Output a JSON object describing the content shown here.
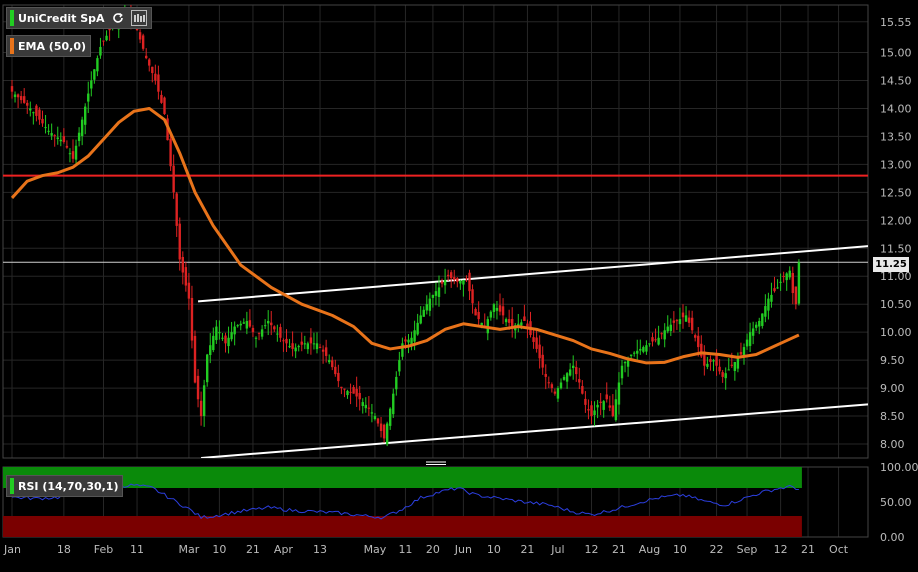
{
  "instrument": {
    "name": "UniCredit SpA",
    "color": "#22cc22",
    "refresh_icon": "refresh-icon",
    "bars_icon": "candlestick-bars-icon"
  },
  "ema": {
    "label": "EMA (50,0)",
    "color": "#e8731a"
  },
  "rsi": {
    "label": "RSI (14,70,30,1)",
    "color": "#22cc22",
    "line_color": "#2c3fe0",
    "overbought_color": "#0a8a0a",
    "oversold_color": "#7a0000"
  },
  "last_price": "11.25",
  "colors": {
    "up": "#22cc22",
    "down": "#dd2222",
    "background": "#000000",
    "grid": "#262626",
    "resistance": "#ee2222",
    "channel": "#ffffff"
  },
  "chart_data": {
    "type": "candlestick",
    "price_axis": {
      "ylim": [
        7.75,
        15.85
      ],
      "ticks": [
        "15.55",
        "15.00",
        "14.50",
        "14.00",
        "13.50",
        "13.00",
        "12.50",
        "12.00",
        "11.50",
        "11.00",
        "10.50",
        "10.00",
        "9.50",
        "9.00",
        "8.50",
        "8.00"
      ]
    },
    "rsi_axis": {
      "ylim": [
        0,
        100
      ],
      "ticks": [
        "100.00",
        "50.00",
        "0.00"
      ],
      "overbought": 70,
      "oversold": 30
    },
    "x_axis": {
      "labels": [
        "Jan",
        "18",
        "Feb",
        "11",
        "Mar",
        "10",
        "21",
        "Apr",
        "13",
        "May",
        "11",
        "20",
        "Jun",
        "10",
        "21",
        "Jul",
        "12",
        "21",
        "Aug",
        "10",
        "22",
        "Sep",
        "12",
        "21",
        "Oct"
      ],
      "days": [
        0,
        17,
        30,
        41,
        58,
        68,
        79,
        89,
        101,
        119,
        129,
        138,
        148,
        158,
        169,
        179,
        190,
        199,
        209,
        219,
        231,
        241,
        252,
        261,
        271
      ]
    },
    "ema_points": [
      [
        0,
        12.4
      ],
      [
        5,
        12.7
      ],
      [
        10,
        12.8
      ],
      [
        15,
        12.85
      ],
      [
        20,
        12.95
      ],
      [
        25,
        13.15
      ],
      [
        30,
        13.45
      ],
      [
        35,
        13.75
      ],
      [
        40,
        13.95
      ],
      [
        45,
        14.0
      ],
      [
        50,
        13.8
      ],
      [
        55,
        13.2
      ],
      [
        60,
        12.5
      ],
      [
        66,
        11.9
      ],
      [
        75,
        11.2
      ],
      [
        85,
        10.8
      ],
      [
        95,
        10.5
      ],
      [
        105,
        10.3
      ],
      [
        112,
        10.1
      ],
      [
        118,
        9.8
      ],
      [
        124,
        9.7
      ],
      [
        130,
        9.75
      ],
      [
        136,
        9.85
      ],
      [
        142,
        10.05
      ],
      [
        148,
        10.15
      ],
      [
        154,
        10.1
      ],
      [
        160,
        10.05
      ],
      [
        166,
        10.1
      ],
      [
        172,
        10.05
      ],
      [
        178,
        9.95
      ],
      [
        184,
        9.85
      ],
      [
        190,
        9.7
      ],
      [
        196,
        9.62
      ],
      [
        202,
        9.52
      ],
      [
        208,
        9.45
      ],
      [
        214,
        9.46
      ],
      [
        220,
        9.56
      ],
      [
        226,
        9.63
      ],
      [
        232,
        9.6
      ],
      [
        238,
        9.55
      ],
      [
        244,
        9.6
      ],
      [
        250,
        9.75
      ],
      [
        254,
        9.85
      ],
      [
        258,
        9.95
      ]
    ],
    "resistance_level": 12.8,
    "channel_upper": [
      [
        61,
        10.55
      ],
      [
        283,
        11.55
      ]
    ],
    "channel_lower": [
      [
        62,
        7.75
      ],
      [
        283,
        8.72
      ]
    ],
    "candle_anchors": [
      [
        0,
        14.3
      ],
      [
        6,
        14.0
      ],
      [
        12,
        13.6
      ],
      [
        17,
        13.4
      ],
      [
        20,
        13.1
      ],
      [
        23,
        13.8
      ],
      [
        26,
        14.5
      ],
      [
        29,
        15.1
      ],
      [
        32,
        15.4
      ],
      [
        35,
        15.6
      ],
      [
        38,
        15.7
      ],
      [
        41,
        15.4
      ],
      [
        44,
        14.9
      ],
      [
        47,
        14.5
      ],
      [
        50,
        13.9
      ],
      [
        53,
        12.5
      ],
      [
        55,
        11.3
      ],
      [
        58,
        10.6
      ],
      [
        60,
        9.1
      ],
      [
        62,
        8.5
      ],
      [
        64,
        9.6
      ],
      [
        67,
        10.1
      ],
      [
        70,
        9.8
      ],
      [
        73,
        10.1
      ],
      [
        77,
        10.2
      ],
      [
        80,
        9.9
      ],
      [
        84,
        10.2
      ],
      [
        88,
        9.9
      ],
      [
        92,
        9.7
      ],
      [
        96,
        9.8
      ],
      [
        100,
        9.8
      ],
      [
        104,
        9.5
      ],
      [
        108,
        9.0
      ],
      [
        112,
        8.9
      ],
      [
        116,
        8.7
      ],
      [
        119,
        8.5
      ],
      [
        122,
        8.1
      ],
      [
        125,
        8.9
      ],
      [
        128,
        9.8
      ],
      [
        131,
        9.9
      ],
      [
        134,
        10.3
      ],
      [
        137,
        10.6
      ],
      [
        140,
        10.8
      ],
      [
        143,
        11.0
      ],
      [
        146,
        10.9
      ],
      [
        149,
        10.95
      ],
      [
        152,
        10.3
      ],
      [
        155,
        10.1
      ],
      [
        158,
        10.5
      ],
      [
        161,
        10.3
      ],
      [
        164,
        10.1
      ],
      [
        168,
        10.2
      ],
      [
        172,
        9.7
      ],
      [
        175,
        9.2
      ],
      [
        178,
        8.9
      ],
      [
        181,
        9.2
      ],
      [
        184,
        9.4
      ],
      [
        186,
        9.1
      ],
      [
        188,
        8.7
      ],
      [
        190,
        8.5
      ],
      [
        192,
        8.7
      ],
      [
        195,
        8.8
      ],
      [
        197,
        8.5
      ],
      [
        200,
        9.4
      ],
      [
        203,
        9.6
      ],
      [
        206,
        9.7
      ],
      [
        209,
        9.8
      ],
      [
        212,
        9.9
      ],
      [
        215,
        10.1
      ],
      [
        218,
        10.2
      ],
      [
        221,
        10.3
      ],
      [
        224,
        9.9
      ],
      [
        227,
        9.4
      ],
      [
        230,
        9.5
      ],
      [
        233,
        9.2
      ],
      [
        236,
        9.4
      ],
      [
        239,
        9.6
      ],
      [
        242,
        10.0
      ],
      [
        245,
        10.2
      ],
      [
        248,
        10.6
      ],
      [
        251,
        10.8
      ],
      [
        253,
        11.0
      ],
      [
        255,
        11.1
      ],
      [
        256,
        10.7
      ],
      [
        257,
        10.5
      ],
      [
        258,
        11.25
      ]
    ],
    "rsi_anchors": [
      [
        0,
        57
      ],
      [
        8,
        55
      ],
      [
        16,
        57
      ],
      [
        24,
        64
      ],
      [
        32,
        72
      ],
      [
        40,
        74
      ],
      [
        46,
        70
      ],
      [
        52,
        55
      ],
      [
        58,
        40
      ],
      [
        62,
        28
      ],
      [
        66,
        30
      ],
      [
        74,
        36
      ],
      [
        84,
        42
      ],
      [
        92,
        38
      ],
      [
        100,
        36
      ],
      [
        108,
        34
      ],
      [
        116,
        30
      ],
      [
        122,
        28
      ],
      [
        128,
        40
      ],
      [
        134,
        56
      ],
      [
        140,
        64
      ],
      [
        146,
        70
      ],
      [
        152,
        60
      ],
      [
        160,
        55
      ],
      [
        168,
        50
      ],
      [
        176,
        46
      ],
      [
        184,
        36
      ],
      [
        190,
        32
      ],
      [
        198,
        40
      ],
      [
        206,
        50
      ],
      [
        212,
        56
      ],
      [
        220,
        60
      ],
      [
        228,
        50
      ],
      [
        234,
        46
      ],
      [
        240,
        55
      ],
      [
        246,
        64
      ],
      [
        252,
        70
      ],
      [
        256,
        72
      ],
      [
        258,
        68
      ]
    ]
  }
}
